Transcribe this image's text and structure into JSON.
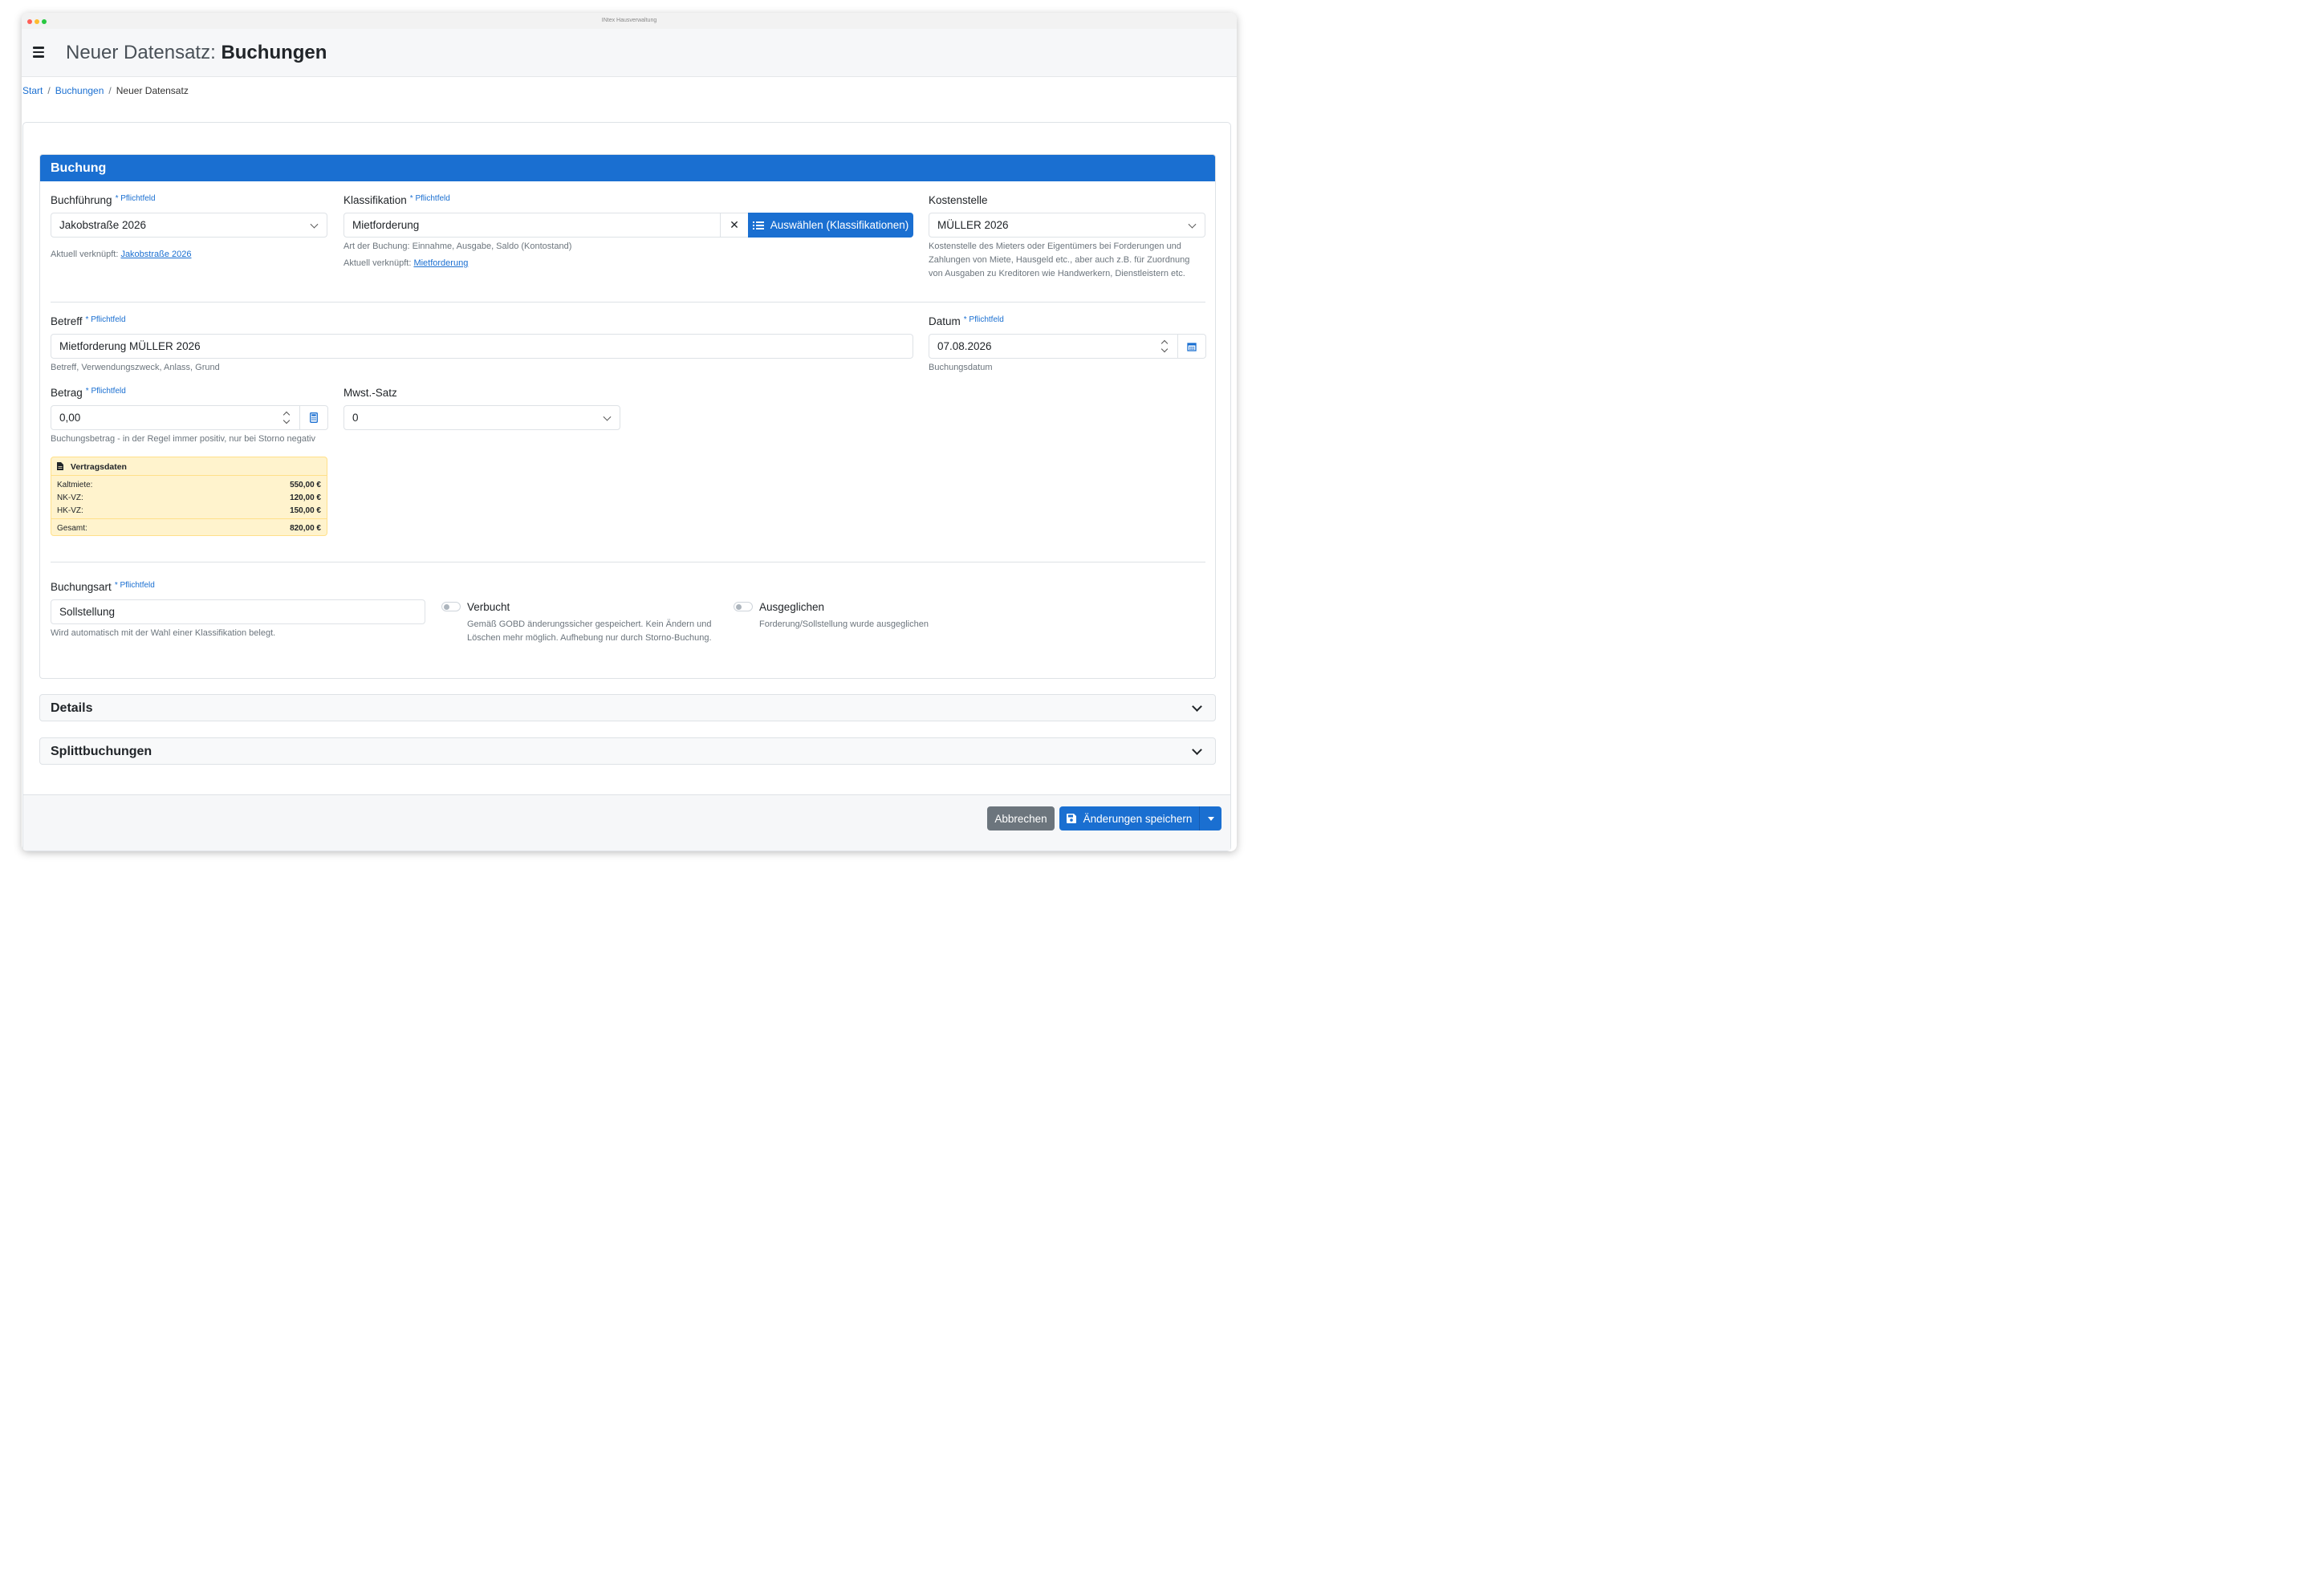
{
  "window": {
    "title": "INtex Hausverwaltung",
    "colors": [
      "#ff5f57",
      "#febc2e",
      "#28c840"
    ]
  },
  "header": {
    "menu_icon": "hamburger-menu-icon",
    "title_prefix": "Neuer Datensatz:",
    "title_entity": "Buchungen"
  },
  "breadcrumb": [
    "Start",
    "Buchungen",
    "Neuer Datensatz"
  ],
  "section": {
    "title": "Buchung"
  },
  "required_label": "* Pflichtfeld",
  "buchfuehrung": {
    "label": "Buchführung",
    "value": "Jakobstraße 2026",
    "help_prefix": "Aktuell verknüpft:",
    "help_link": "Jakobstraße 2026"
  },
  "klassifikation": {
    "label": "Klassifikation",
    "value": "Mietforderung",
    "clear_label": "✕",
    "select_button": "Auswählen (Klassifikationen)",
    "help_line1": "Art der Buchung: Einnahme, Ausgabe, Saldo (Kontostand)",
    "help_prefix": "Aktuell verknüpft:",
    "help_link": "Mietforderung"
  },
  "kostenstelle": {
    "label": "Kostenstelle",
    "value": "MÜLLER 2026",
    "help": "Kostenstelle des Mieters oder Eigentümers bei Forderungen und Zahlungen von Miete, Hausgeld etc., aber auch z.B. für Zuordnung von Ausgaben zu Kreditoren wie Handwerkern, Dienstleistern etc."
  },
  "betreff": {
    "label": "Betreff",
    "value": "Mietforderung MÜLLER 2026",
    "help": "Betreff, Verwendungszweck, Anlass, Grund"
  },
  "datum": {
    "label": "Datum",
    "value": "07.08.2026",
    "help": "Buchungsdatum"
  },
  "betrag": {
    "label": "Betrag",
    "value": "0,00",
    "help": "Buchungsbetrag - in der Regel immer positiv, nur bei Storno negativ"
  },
  "mwst": {
    "label": "Mwst.-Satz",
    "value": "0"
  },
  "vertragsdaten": {
    "title": "Vertragsdaten",
    "rows": [
      {
        "label": "Kaltmiete:",
        "value": "550,00 €"
      },
      {
        "label": "NK-VZ:",
        "value": "120,00 €"
      },
      {
        "label": "HK-VZ:",
        "value": "150,00 €"
      }
    ],
    "total": {
      "label": "Gesamt:",
      "value": "820,00 €"
    }
  },
  "buchungsart": {
    "label": "Buchungsart",
    "value": "Sollstellung",
    "help": "Wird automatisch mit der Wahl einer Klassifikation belegt."
  },
  "verbucht": {
    "label": "Verbucht",
    "checked": false,
    "help": "Gemäß GOBD änderungssicher gespeichert. Kein Ändern und Löschen mehr möglich. Aufhebung nur durch Storno-Buchung."
  },
  "ausgeglichen": {
    "label": "Ausgeglichen",
    "checked": false,
    "help": "Forderung/Sollstellung wurde ausgeglichen"
  },
  "accordions": [
    "Details",
    "Splittbuchungen"
  ],
  "footer": {
    "cancel": "Abbrechen",
    "save": "Änderungen speichern"
  }
}
